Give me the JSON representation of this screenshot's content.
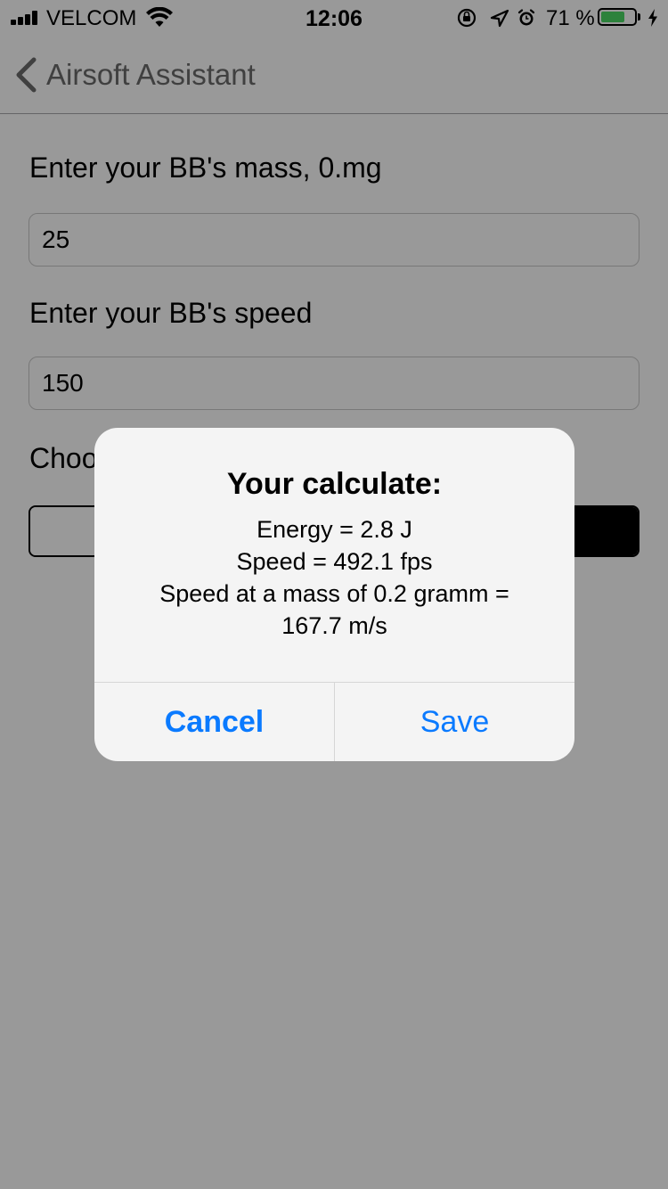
{
  "status_bar": {
    "carrier": "VELCOM",
    "time": "12:06",
    "battery_percent": "71 %",
    "battery_level": 0.71,
    "icons": [
      "signal-icon",
      "wifi-icon",
      "orientation-lock-icon",
      "location-arrow-icon",
      "alarm-icon",
      "battery-icon",
      "charging-icon"
    ]
  },
  "nav": {
    "back_label": "Airsoft Assistant",
    "back_icon": "chevron-left-icon"
  },
  "form": {
    "mass_label": "Enter your BB's mass, 0.mg",
    "mass_value": "25",
    "speed_label": "Enter your BB's speed",
    "speed_value": "150",
    "choose_label": "Choo"
  },
  "alert": {
    "title": "Your calculate:",
    "lines": [
      "Energy = 2.8 J",
      "Speed = 492.1 fps",
      "Speed at a mass of 0.2 gramm =",
      "167.7 m/s"
    ],
    "cancel_label": "Cancel",
    "save_label": "Save",
    "button_color": "#0a7aff"
  },
  "colors": {
    "overlay": "rgba(0,0,0,0.4)",
    "battery_fill": "#4cd964"
  }
}
